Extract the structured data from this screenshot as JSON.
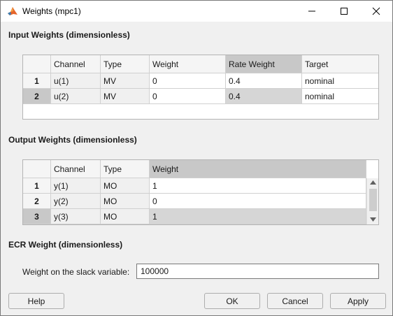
{
  "window": {
    "title": "Weights (mpc1)",
    "icon": "matlab-icon"
  },
  "input_section": {
    "title": "Input Weights (dimensionless)",
    "columns": [
      "Channel",
      "Type",
      "Weight",
      "Rate Weight",
      "Target"
    ],
    "rows": [
      {
        "index": "1",
        "channel": "u(1)",
        "type": "MV",
        "weight": "0",
        "rate_weight": "0.4",
        "target": "nominal"
      },
      {
        "index": "2",
        "channel": "u(2)",
        "type": "MV",
        "weight": "0",
        "rate_weight": "0.4",
        "target": "nominal"
      }
    ]
  },
  "output_section": {
    "title": "Output Weights (dimensionless)",
    "columns": [
      "Channel",
      "Type",
      "Weight"
    ],
    "rows": [
      {
        "index": "1",
        "channel": "y(1)",
        "type": "MO",
        "weight": "1"
      },
      {
        "index": "2",
        "channel": "y(2)",
        "type": "MO",
        "weight": "0"
      },
      {
        "index": "3",
        "channel": "y(3)",
        "type": "MO",
        "weight": "1"
      }
    ]
  },
  "ecr_section": {
    "title": "ECR Weight (dimensionless)",
    "label": "Weight on the slack variable:",
    "value": "100000"
  },
  "buttons": {
    "help": "Help",
    "ok": "OK",
    "cancel": "Cancel",
    "apply": "Apply"
  }
}
